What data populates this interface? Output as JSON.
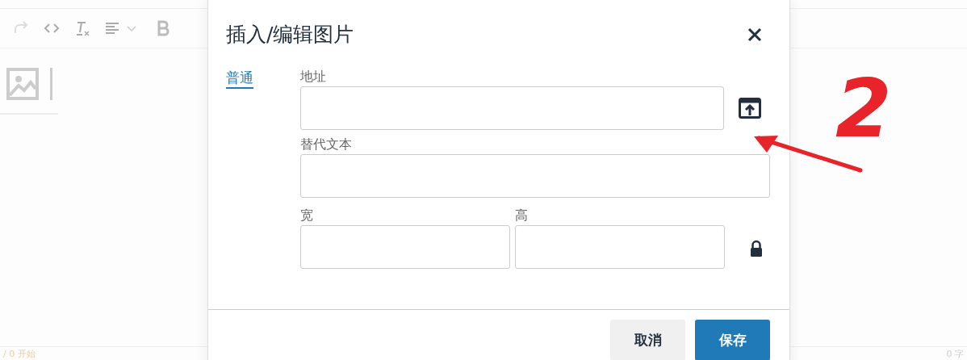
{
  "editor": {
    "toolbar": [
      {
        "kind": "redo"
      },
      {
        "kind": "code"
      },
      {
        "kind": "clear-format"
      },
      {
        "kind": "align"
      },
      {
        "kind": "bold"
      }
    ],
    "status_left": "/ 0  开始",
    "status_right": "0 字"
  },
  "dialog": {
    "title": "插入/编辑图片",
    "tabs": [
      {
        "label": "普通",
        "selected": true
      }
    ],
    "fields": [
      {
        "kind": "url",
        "label": "地址"
      },
      {
        "kind": "text",
        "label": "替代文本"
      }
    ],
    "size": {
      "width_label": "宽",
      "height_label": "高",
      "locked": true
    },
    "buttons": [
      {
        "label": "取消",
        "kind": "secondary"
      },
      {
        "label": "保存",
        "kind": "primary"
      }
    ]
  },
  "annotation": {
    "text": "2"
  }
}
